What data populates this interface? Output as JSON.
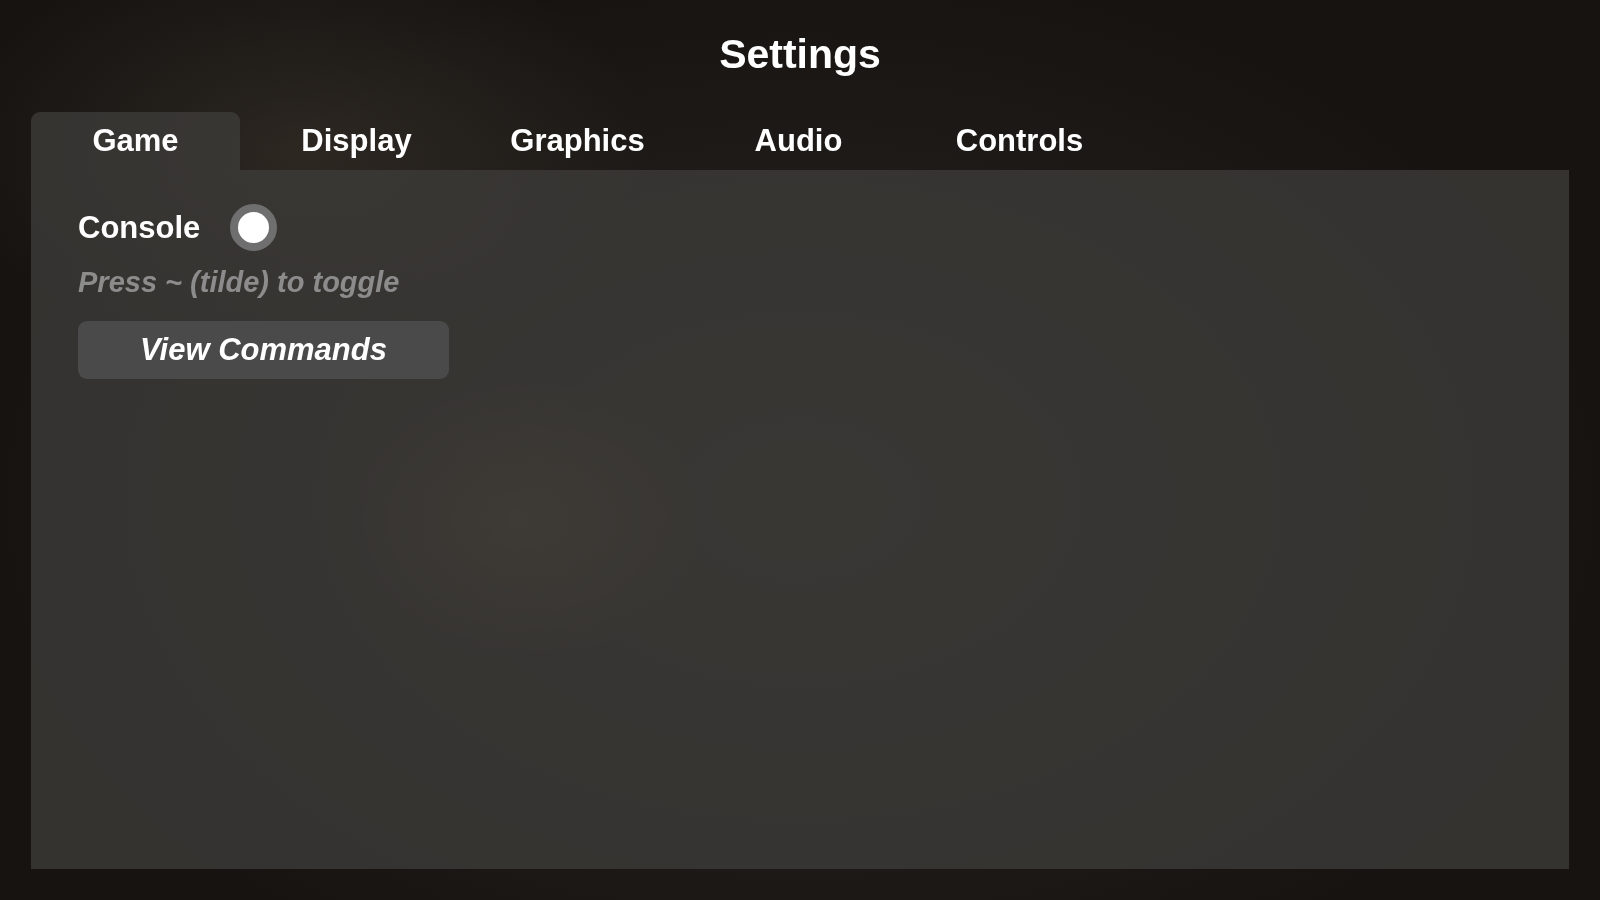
{
  "title": "Settings",
  "tabs": [
    {
      "label": "Game",
      "selected": true
    },
    {
      "label": "Display",
      "selected": false
    },
    {
      "label": "Graphics",
      "selected": false
    },
    {
      "label": "Audio",
      "selected": false
    },
    {
      "label": "Controls",
      "selected": false
    }
  ],
  "game_settings": [
    {
      "kind": "toggle",
      "label": "Console",
      "checked": true,
      "hint": "Press ~ (tilde) to toggle"
    },
    {
      "kind": "button",
      "label": "View Commands"
    }
  ]
}
